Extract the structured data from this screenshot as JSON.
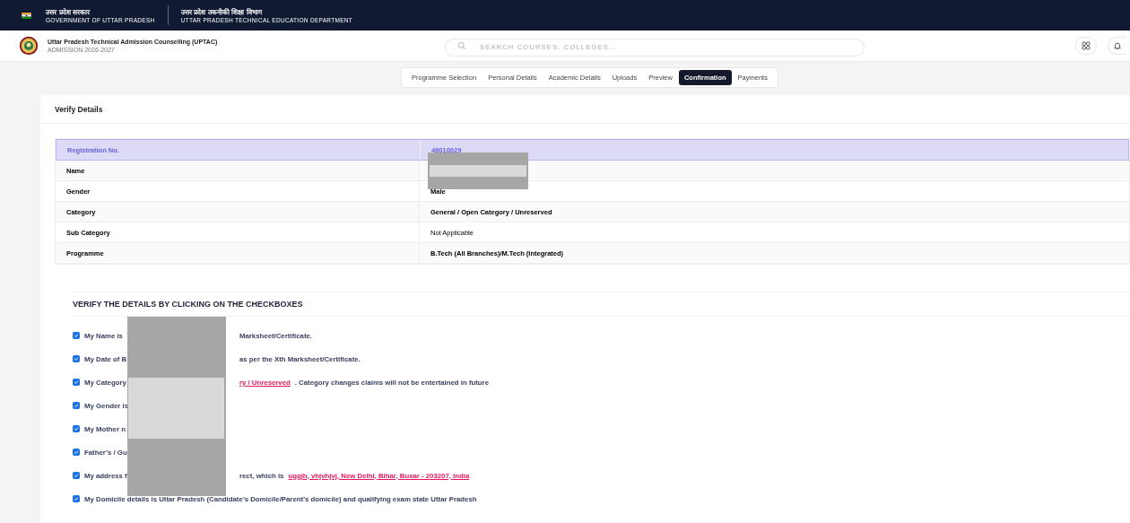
{
  "gov_bar": {
    "left": {
      "hindi": "उत्तर प्रदेश सरकार",
      "english": "GOVERNMENT OF UTTAR PRADESH"
    },
    "right": {
      "hindi": "उत्तर प्रदेश तकनीकी शिक्षा विभाग",
      "english": "UTTAR PRADESH TECHNICAL EDUCATION DEPARTMENT"
    }
  },
  "header": {
    "title": "Uttar Pradesh Technical Admission Counselling (UPTAC)",
    "subtitle": "ADMISSION 2026-2027",
    "search": {
      "placeholder": "SEARCH COURSES, COLLEGES..."
    }
  },
  "tabs": [
    {
      "label": "Programme Selection",
      "selected": false
    },
    {
      "label": "Personal Details",
      "selected": false
    },
    {
      "label": "Academic Details",
      "selected": false
    },
    {
      "label": "Uploads",
      "selected": false
    },
    {
      "label": "Preview",
      "selected": false
    },
    {
      "label": "Confirmation",
      "selected": true
    },
    {
      "label": "Payments",
      "selected": false
    }
  ],
  "card": {
    "title": "Verify Details",
    "table": {
      "rows": [
        {
          "label": "Registration No.",
          "value": "46010029",
          "highlight": true
        },
        {
          "label": "Name",
          "highlight": false
        },
        {
          "label": "Gender",
          "value": "Male",
          "highlight": false
        },
        {
          "label": "Category",
          "value": "General / Open Category / Unreserved",
          "highlight": false
        },
        {
          "label": "Sub Category",
          "value": "Not Applicable",
          "highlight": false
        },
        {
          "label": "Programme",
          "value": "B.Tech (All Branches)/M.Tech (Integrated)",
          "highlight": false
        }
      ]
    },
    "verify": {
      "heading": "VERIFY THE DETAILS BY CLICKING ON THE CHECKBOXES",
      "items": [
        {
          "checked": true,
          "lead": "My Name is",
          "segments": [
            {
              "kind": "plain",
              "text": "Marksheet/Certificate."
            }
          ]
        },
        {
          "checked": true,
          "lead": "My Date of B",
          "segments": [
            {
              "kind": "plain",
              "text": "as per the Xth Marksheet/Certificate."
            }
          ]
        },
        {
          "checked": true,
          "lead": "My Category",
          "segments": [
            {
              "kind": "link",
              "text": "ry / Unreserved"
            },
            {
              "kind": "plain",
              "text": ". Category changes claims will not be entertained in future"
            }
          ]
        },
        {
          "checked": true,
          "lead": "My Gender is"
        },
        {
          "checked": true,
          "lead": "My Mother n"
        },
        {
          "checked": true,
          "lead": "Father’s / Gu"
        },
        {
          "checked": true,
          "lead": "My address f",
          "segments": [
            {
              "kind": "plain",
              "text": "rect, which is"
            },
            {
              "kind": "link",
              "text": "uggjh, vhjvhjvj, New Delhi, Bihar, Buxar - 203207, India"
            }
          ]
        },
        {
          "checked": true,
          "full": "My Domicile details is Uttar Pradesh (Candidate’s Domicile/Parent’s domicile) and qualifying exam state Uttar Pradesh"
        }
      ]
    }
  }
}
